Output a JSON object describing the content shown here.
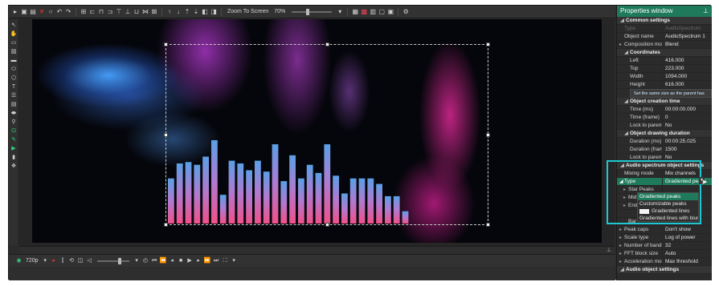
{
  "toolbar": {
    "zoom_mode": "Zoom To Screen",
    "zoom_value": "70%",
    "icons": [
      "select-icon",
      "copy-icon",
      "delete-icon",
      "stop-icon",
      "undo-icon",
      "redo-icon",
      "move-icon",
      "align-left-icon",
      "align-center-icon",
      "align-right-icon",
      "align-top-icon",
      "align-middle-icon",
      "align-bottom-icon",
      "distribute-icon",
      "fit-icon",
      "arrow-up-icon",
      "arrow-down-icon",
      "bring-front-icon",
      "send-back-icon",
      "group-icon",
      "ungroup-icon"
    ]
  },
  "left_tools": [
    "pointer-icon",
    "hand-icon",
    "video-icon",
    "image-icon",
    "rectangle-icon",
    "ellipse-icon",
    "polygon-icon",
    "text-icon",
    "subtitle-icon",
    "chart-icon",
    "sprite-icon",
    "audio-spectrum-icon",
    "effect-icon",
    "cross-icon",
    "transition-icon",
    "move-icon"
  ],
  "playback": {
    "resolution": "720p",
    "buttons": [
      "record-icon",
      "mark-icon",
      "loop-icon",
      "snapshot-icon",
      "volume-icon",
      "clock-icon",
      "first-frame-icon",
      "prev-fast-icon",
      "prev-frame-icon",
      "stop-icon",
      "play-icon",
      "next-frame-icon",
      "next-fast-icon",
      "last-frame-icon",
      "fullscreen-icon"
    ]
  },
  "properties": {
    "title": "Properties window",
    "common_settings": "Common settings",
    "type_label": "Type",
    "type_value": "AudioSpectrum",
    "object_name_label": "Object name",
    "object_name_value": "AudioSpectrum 1",
    "composition_label": "Composition mode",
    "composition_value": "Blend",
    "coordinates": "Coordinates",
    "left_label": "Left",
    "left_value": "416.000",
    "top_label": "Top",
    "top_value": "223.000",
    "width_label": "Width",
    "width_value": "1094.000",
    "height_label": "Height",
    "height_value": "616.000",
    "parent_size_button": "Set the same size as the parent has",
    "creation_time": "Object creation time",
    "time_ms_label": "Time (ms)",
    "time_ms_value": "00:00:00.000",
    "time_frame_label": "Time (frame)",
    "time_frame_value": "0",
    "lock_parent_label": "Lock to parent d",
    "lock_parent_value": "No",
    "drawing_duration": "Object drawing duration",
    "duration_ms_label": "Duration (ms)",
    "duration_ms_value": "00:00:25.025",
    "duration_frames_label": "Duration (frames",
    "duration_frames_value": "1500",
    "lock_parent2_label": "Lock to parent d",
    "lock_parent2_value": "No",
    "audio_spectrum_settings": "Audio spectrum object settings",
    "mixing_mode_label": "Mixing mode",
    "mixing_mode_value": "Mix channels",
    "spectrum_type_label": "Type",
    "spectrum_type_value": "Gradiented peaks",
    "start_peaks_label": "Star Peaks",
    "mid_label": "Mid",
    "end_label": "End",
    "bar_label": "Bar",
    "peak_caps_label": "Peak caps",
    "peak_caps_value": "Don't show",
    "scale_type_label": "Scale type",
    "scale_type_value": "Log of power",
    "bands_label": "Number of bands",
    "bands_value": "32",
    "fft_label": "FFT block size",
    "fft_value": "Auto",
    "accel_label": "Acceleration mode",
    "accel_value": "Max threshold",
    "audio_object_settings": "Audio object settings"
  },
  "type_dropdown": {
    "options": [
      "Gradiented peaks",
      "Customizable peaks",
      "Gradiented lines",
      "Gradiented lines with blur"
    ],
    "selected": "Gradiented peaks"
  },
  "colors": {
    "accent": "#1f7a5b",
    "highlight": "#1ec8d2",
    "bar_top": "#5aa0e6",
    "bar_bottom": "#f0508a"
  },
  "chart_data": {
    "type": "bar",
    "values": [
      0.33,
      0.44,
      0.45,
      0.43,
      0.49,
      0.61,
      0.21,
      0.46,
      0.44,
      0.39,
      0.46,
      0.38,
      0.58,
      0.31,
      0.5,
      0.33,
      0.43,
      0.37,
      0.58,
      0.35,
      0.22,
      0.33,
      0.33,
      0.33,
      0.29,
      0.2,
      0.2,
      0.09
    ]
  }
}
